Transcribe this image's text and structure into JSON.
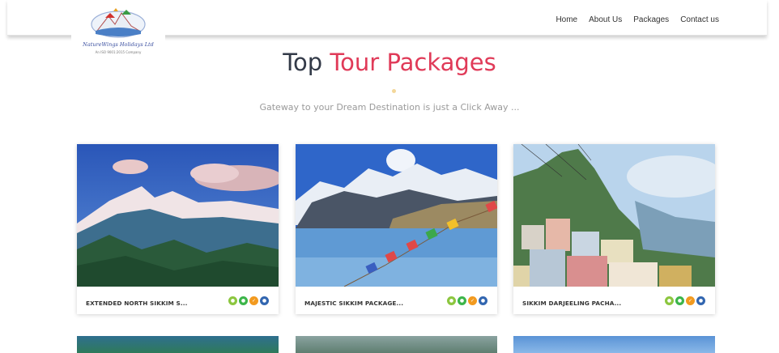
{
  "brand": {
    "name": "NatureWings Holidays Ltd",
    "tagline": "An ISO 9001:2015 Company"
  },
  "nav": [
    {
      "label": "Home"
    },
    {
      "label": "About Us"
    },
    {
      "label": "Packages"
    },
    {
      "label": "Contact us"
    }
  ],
  "section": {
    "title_main": "Top",
    "title_accent": "Tour Packages",
    "subtitle": "Gateway to your Dream Destination is just a Click Away ..."
  },
  "packages": [
    {
      "name": "EXTENDED NORTH SIKKIM S...",
      "icons": [
        "sightseeing-icon",
        "meals-icon",
        "hotel-icon",
        "transport-icon"
      ]
    },
    {
      "name": "MAJESTIC SIKKIM PACKAGE...",
      "icons": [
        "sightseeing-icon",
        "meals-icon",
        "hotel-icon",
        "transport-icon"
      ]
    },
    {
      "name": "SIKKIM DARJEELING PACHA...",
      "icons": [
        "sightseeing-icon",
        "meals-icon",
        "hotel-icon",
        "transport-icon"
      ]
    }
  ],
  "colors": {
    "accent": "#e03a58",
    "heading": "#333a48",
    "icon_green_light": "#8cc63f",
    "icon_green": "#3cb54a",
    "icon_orange": "#f29a1f",
    "icon_blue": "#3266b0"
  }
}
